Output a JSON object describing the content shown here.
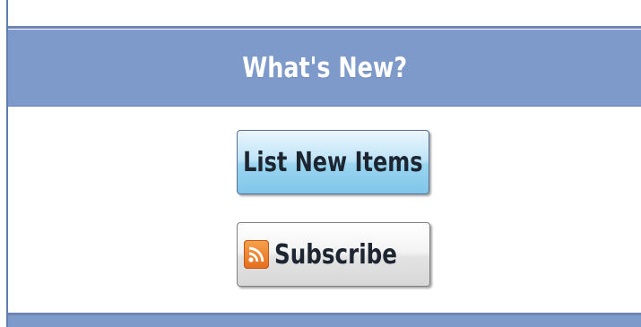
{
  "panel": {
    "title": "What's New?"
  },
  "buttons": {
    "list_new_items": "List New Items",
    "subscribe": "Subscribe"
  },
  "icons": {
    "subscribe_icon": "rss-icon"
  },
  "colors": {
    "header_blue": "#7e9aca",
    "button_blue": "#9ad5f0",
    "rss_orange": "#e56d1d"
  }
}
